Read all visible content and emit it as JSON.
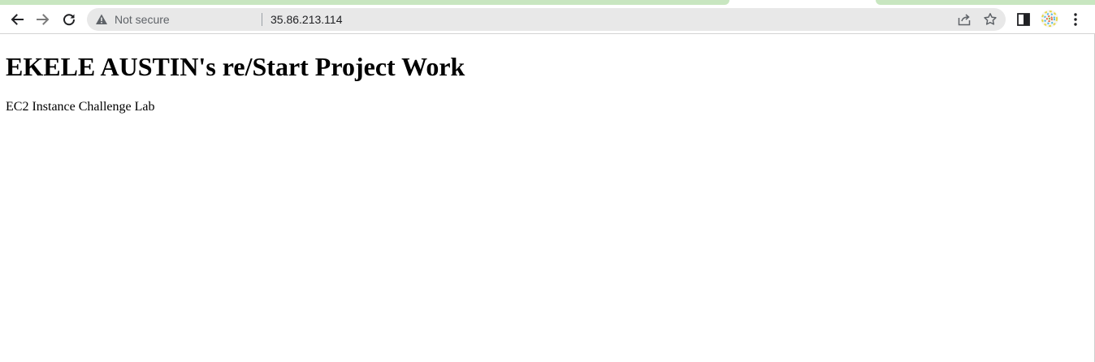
{
  "browser": {
    "security_label": "Not secure",
    "url": "35.86.213.114",
    "accent_tab_color": "#c8e6c0",
    "icons": [
      "back-arrow-icon",
      "forward-arrow-icon",
      "reload-icon",
      "warning-icon",
      "share-icon",
      "star-icon",
      "side-panel-icon",
      "profile-avatar",
      "kebab-menu-icon"
    ]
  },
  "page": {
    "heading": "EKELE AUSTIN's re/Start Project Work",
    "paragraph": "EC2 Instance Challenge Lab"
  }
}
